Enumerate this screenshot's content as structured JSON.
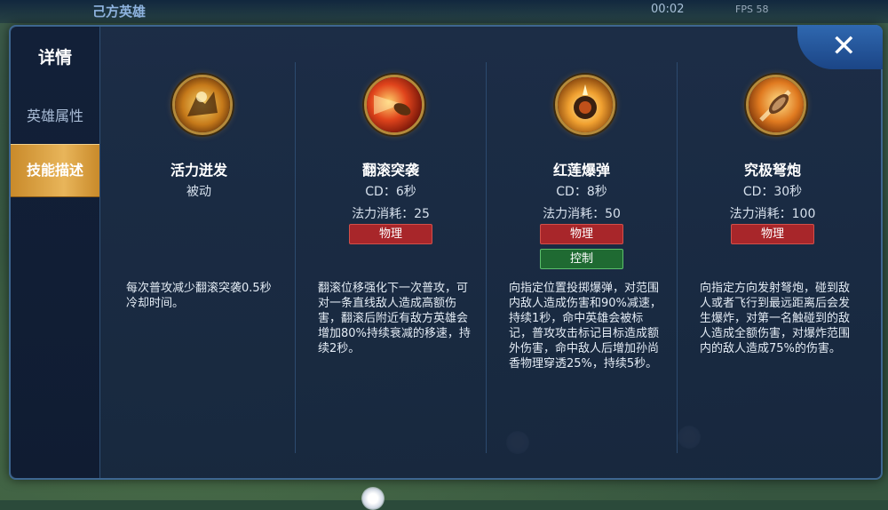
{
  "topbar": {
    "ally_title": "己方英雄",
    "timer": "00:02",
    "fps": "FPS 58"
  },
  "sidebar": {
    "title": "详情",
    "tabs": [
      {
        "label": "英雄属性",
        "selected": false
      },
      {
        "label": "技能描述",
        "selected": true
      }
    ]
  },
  "close_icon": "close-icon",
  "skills": [
    {
      "name": "活力迸发",
      "line1": "被动",
      "line2": "",
      "tags": [],
      "description": "每次普攻减少翻滚突袭0.5秒冷却时间。",
      "icon": "passive-skill-icon"
    },
    {
      "name": "翻滚突袭",
      "line1": "CD：6秒",
      "line2": "法力消耗：25",
      "tags": [
        "物理"
      ],
      "description": "翻滚位移强化下一次普攻，可对一条直线敌人造成高额伤害，翻滚后附近有敌方英雄会增加80%持续衰减的移速，持续2秒。",
      "icon": "bullet-skill-icon"
    },
    {
      "name": "红莲爆弹",
      "line1": "CD：8秒",
      "line2": "法力消耗：50",
      "tags": [
        "物理",
        "控制"
      ],
      "description": "向指定位置投掷爆弹，对范围内敌人造成伤害和90%减速，持续1秒，命中英雄会被标记，普攻攻击标记目标造成额外伤害，命中敌人后增加孙尚香物理穿透25%，持续5秒。",
      "icon": "bomb-skill-icon"
    },
    {
      "name": "究极弩炮",
      "line1": "CD：30秒",
      "line2": "法力消耗：100",
      "tags": [
        "物理"
      ],
      "description": "向指定方向发射弩炮，碰到敌人或者飞行到最远距离后会发生爆炸，对第一名触碰到的敌人造成全额伤害，对爆炸范围内的敌人造成75%的伤害。",
      "icon": "ballista-skill-icon"
    }
  ],
  "colors": {
    "panel_bg": "#1a2a46",
    "tab_selected": "#e8b55a",
    "tag_physical": "#a8262a",
    "tag_control": "#1f6a32"
  }
}
